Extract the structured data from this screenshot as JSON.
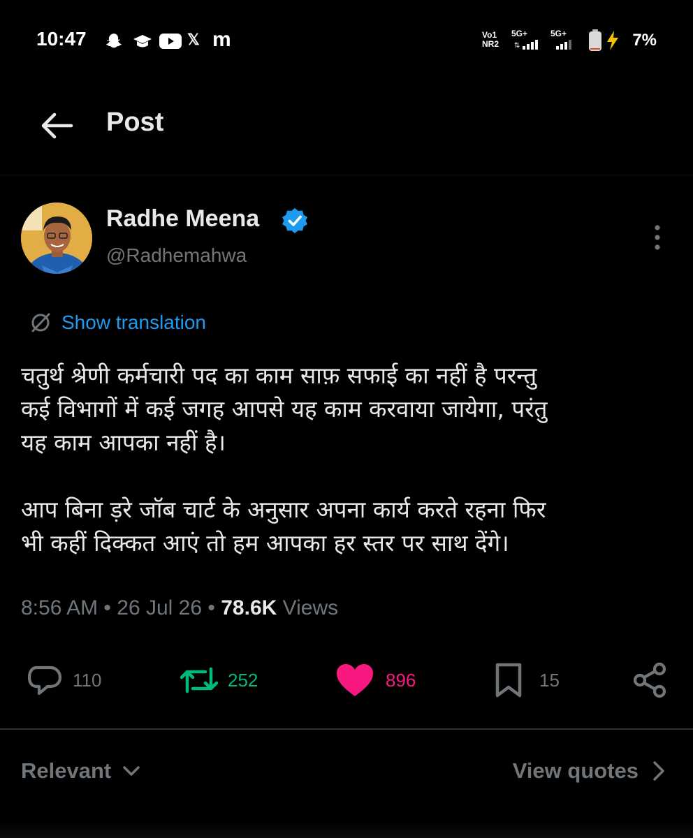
{
  "status_bar": {
    "time": "10:47",
    "app_icons": [
      "snapchat-icon",
      "graduation-cap-icon",
      "youtube-icon",
      "x-icon",
      "m-icon"
    ],
    "sim1_top": "Vo1",
    "sim1_bottom": "NR2",
    "net1": "5G+",
    "net2": "5G+",
    "battery_percent": "7%",
    "m_glyph": "m",
    "x_glyph": "𝕏"
  },
  "header": {
    "title": "Post"
  },
  "author": {
    "name": "Radhe Meena",
    "handle": "@Radhemahwa",
    "verified": true
  },
  "translation": {
    "label": "Show translation"
  },
  "post": {
    "paragraph1": "चतुर्थ श्रेणी कर्मचारी पद का काम साफ़ सफाई का नहीं है परन्तु\nकई विभागों में कई जगह आपसे यह काम करवाया जायेगा, परंतु\nयह काम आपका नहीं है।",
    "paragraph2": "आप बिना ड़रे जॉब चार्ट के अनुसार अपना कार्य करते रहना फिर\nभी कहीं दिक्कत आएं तो हम आपका हर स्तर पर साथ देंगे।"
  },
  "meta": {
    "time": "8:56 AM",
    "separator": "•",
    "date": "26 Jul 26",
    "views_count": "78.6K",
    "views_label": "Views"
  },
  "actions": {
    "replies": "110",
    "reposts": "252",
    "likes": "896",
    "bookmarks": "15"
  },
  "colors": {
    "background": "#000000",
    "text": "#e7e9ea",
    "muted": "#71767b",
    "link": "#1d9bf0",
    "repost_green": "#00ba7c",
    "like_pink": "#f91880"
  },
  "footer": {
    "sort_label": "Relevant",
    "quotes_label": "View quotes"
  }
}
